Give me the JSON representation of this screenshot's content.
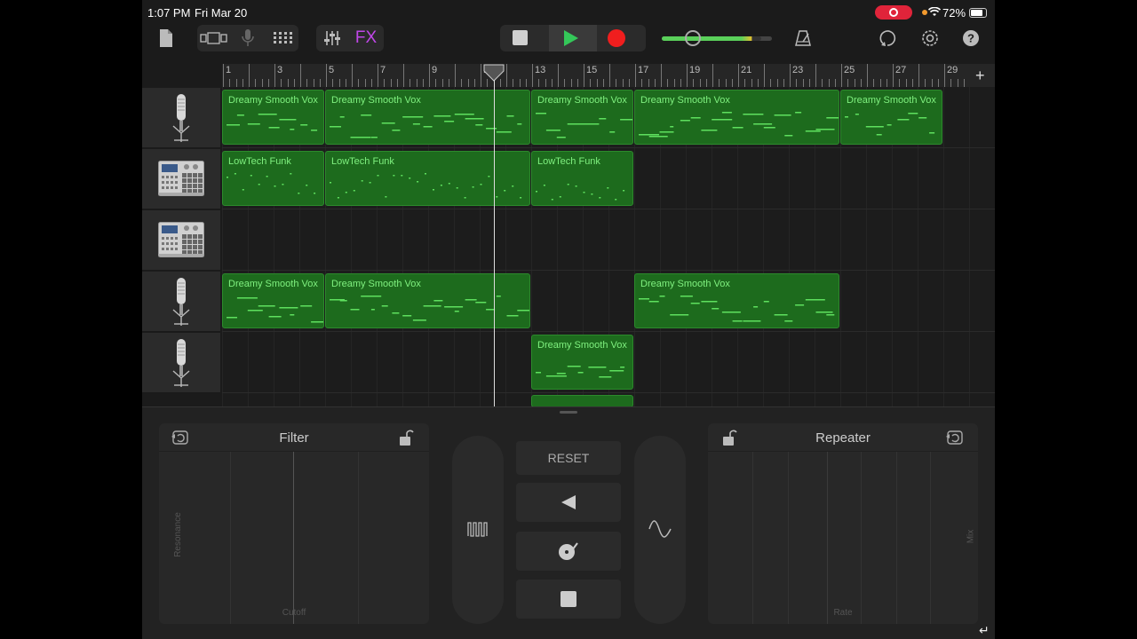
{
  "status_bar": {
    "time": "1:07 PM",
    "date": "Fri Mar 20",
    "battery": "72%"
  },
  "toolbar": {
    "fx_label": "FX",
    "icons": [
      "document-icon",
      "view-toggle-icon",
      "mic-icon",
      "grid-icon",
      "mixer-icon",
      "metronome-icon",
      "loop-icon",
      "settings-icon",
      "help-icon"
    ],
    "volume_level": 0.22
  },
  "ruler": {
    "bars": [
      "1",
      "3",
      "5",
      "7",
      "9",
      "11",
      "13",
      "15",
      "17",
      "19",
      "21",
      "23",
      "25",
      "27",
      "29"
    ]
  },
  "tracks": [
    {
      "instrument": "microphone",
      "regions": [
        {
          "name": "Dreamy Smooth Vox",
          "start": 1,
          "end": 5
        },
        {
          "name": "Dreamy Smooth Vox",
          "start": 5,
          "end": 13
        },
        {
          "name": "Dreamy Smooth Vox",
          "start": 13,
          "end": 17
        },
        {
          "name": "Dreamy Smooth Vox",
          "start": 17,
          "end": 25
        },
        {
          "name": "Dreamy Smooth Vox",
          "start": 25,
          "end": 29
        }
      ]
    },
    {
      "instrument": "drum-machine",
      "regions": [
        {
          "name": "LowTech Funk",
          "start": 1,
          "end": 5
        },
        {
          "name": "LowTech Funk",
          "start": 5,
          "end": 13
        },
        {
          "name": "LowTech Funk",
          "start": 13,
          "end": 17
        }
      ]
    },
    {
      "instrument": "drum-machine",
      "regions": []
    },
    {
      "instrument": "microphone",
      "regions": [
        {
          "name": "Dreamy Smooth Vox",
          "start": 1,
          "end": 5
        },
        {
          "name": "Dreamy Smooth Vox",
          "start": 5,
          "end": 13
        },
        {
          "name": "Dreamy Smooth Vox",
          "start": 17,
          "end": 25
        }
      ]
    },
    {
      "instrument": "microphone",
      "regions": [
        {
          "name": "Dreamy Smooth Vox",
          "start": 13,
          "end": 17
        }
      ]
    }
  ],
  "playhead_bar": 11,
  "fx_panel": {
    "filter": {
      "title": "Filter",
      "x_axis": "Cutoff",
      "y_axis": "Resonance"
    },
    "repeater": {
      "title": "Repeater",
      "x_axis": "Rate",
      "y_axis": "Mix"
    },
    "reset_label": "RESET",
    "controls": [
      "reverse-icon",
      "scratch-icon",
      "stop-icon"
    ],
    "left_pill_icon": "gate-icon",
    "right_pill_icon": "wave-icon"
  }
}
